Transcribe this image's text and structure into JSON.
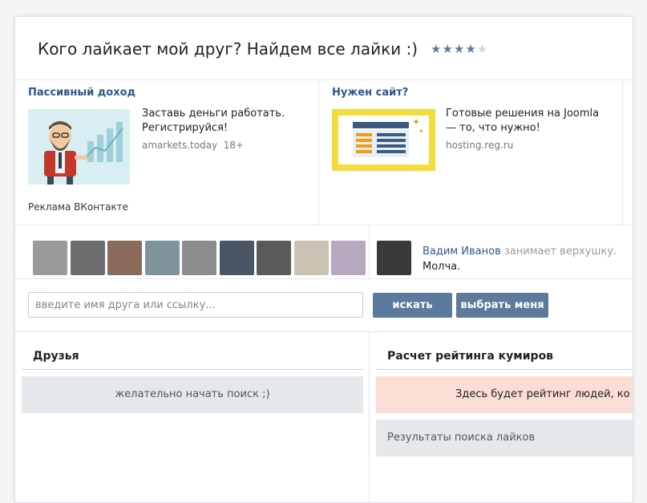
{
  "header": {
    "title": "Кого лайкает мой друг? Найдем все лайки :)",
    "rating": {
      "filled": 4,
      "total": 5
    },
    "star_glyph": "★"
  },
  "ads": [
    {
      "title": "Пассивный доход",
      "text": "Заставь деньги работать. Регистрируйся!",
      "domain": "amarkets.today",
      "age": "18+",
      "image_icon": "businessman-chart-icon"
    },
    {
      "title": "Нужен сайт?",
      "text": "Готовые решения на Joomla — то, что нужно!",
      "domain": "hosting.reg.ru",
      "image_icon": "website-template-icon"
    }
  ],
  "ads_footer": "Реклама ВКонтакте",
  "friends_strip": {
    "avatar_colors": [
      "#9a9a9a",
      "#6e6e6e",
      "#8a6a5a",
      "#7f949a",
      "#8c8c8c",
      "#4a5566",
      "#5a5a5a",
      "#c9c2b2",
      "#b7a7bf"
    ],
    "featured_avatar_color": "#3a3a3a",
    "status_name": "Вадим Иванов",
    "status_text": "занимает верхушку.",
    "status_sub": "Молча."
  },
  "search": {
    "placeholder": "введите имя друга или ссылку...",
    "value": "",
    "search_button": "искать",
    "pick_me_button": "выбрать меня"
  },
  "friends_panel": {
    "title": "Друзья",
    "empty_message": "желательно начать поиск ;)"
  },
  "rating_panel": {
    "title": "Расчет рейтинга кумиров",
    "notice": "Здесь будет рейтинг людей, ко",
    "results_label": "Результаты поиска лайков"
  },
  "colors": {
    "link": "#2b5788",
    "button": "#5b7a9c",
    "notice_bg": "#fbddd6",
    "panel_bg": "#e5e8eb"
  }
}
